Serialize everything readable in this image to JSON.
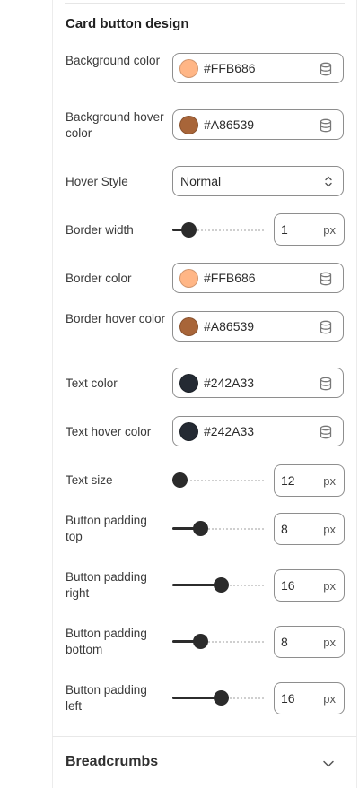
{
  "section": {
    "title": "Card button design"
  },
  "rows": {
    "bg_color": {
      "label": "Background color",
      "value": "#FFB686",
      "swatch": "#FFB686"
    },
    "bg_hover": {
      "label": "Background hover color",
      "value": "#A86539",
      "swatch": "#A86539"
    },
    "hover_style": {
      "label": "Hover Style",
      "value": "Normal"
    },
    "border_width": {
      "label": "Border width",
      "value": "1",
      "unit": "px",
      "fraction": 0.17
    },
    "border_color": {
      "label": "Border color",
      "value": "#FFB686",
      "swatch": "#FFB686"
    },
    "border_hover": {
      "label": "Border hover color",
      "value": "#A86539",
      "swatch": "#A86539"
    },
    "text_color": {
      "label": "Text color",
      "value": "#242A33",
      "swatch": "#242A33"
    },
    "text_hover": {
      "label": "Text hover color",
      "value": "#242A33",
      "swatch": "#242A33"
    },
    "text_size": {
      "label": "Text size",
      "value": "12",
      "unit": "px",
      "fraction": 0.08
    },
    "pad_top": {
      "label": "Button padding top",
      "value": "8",
      "unit": "px",
      "fraction": 0.3
    },
    "pad_right": {
      "label": "Button padding right",
      "value": "16",
      "unit": "px",
      "fraction": 0.52
    },
    "pad_bottom": {
      "label": "Button padding bottom",
      "value": "8",
      "unit": "px",
      "fraction": 0.3
    },
    "pad_left": {
      "label": "Button padding left",
      "value": "16",
      "unit": "px",
      "fraction": 0.52
    }
  },
  "breadcrumbs": {
    "title": "Breadcrumbs"
  },
  "icons": {
    "db": "database-icon",
    "select": "chevron-up-down-icon",
    "collapse": "chevron-down-icon"
  }
}
